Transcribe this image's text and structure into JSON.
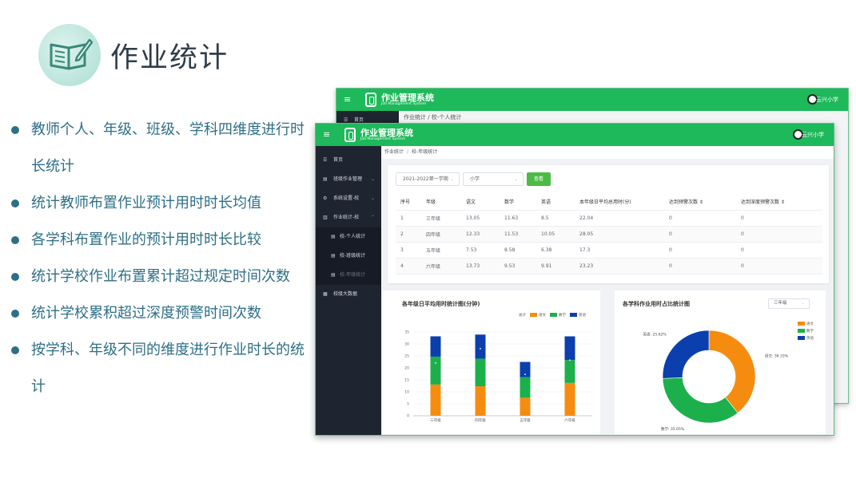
{
  "slide": {
    "title": "作业统计",
    "bullets": [
      "教师个人、年级、班级、学科四维度进行时长统计",
      "统计教师布置作业预计用时时长均值",
      "各学科布置作业的预计用时时长比较",
      "统计学校作业布置累计超过规定时间次数",
      "统计学校累积超过深度预警时间次数",
      "按学科、年级不同的维度进行作业时长的统计"
    ],
    "icon": "book-pen-icon",
    "accent": "#2e6f86"
  },
  "back_window": {
    "nav_first": "首页",
    "crumb": "作业统计 / 校-个人统计"
  },
  "app": {
    "logo_title": "作业管理系统",
    "logo_sub": "Job Management System",
    "user_name": "云兴小学",
    "header_color": "#1db95a",
    "sidebar": [
      {
        "label": "首页",
        "icon": "home-icon"
      },
      {
        "label": "班级作业管理",
        "icon": "doc-icon",
        "arrow": "⌄"
      },
      {
        "label": "系统设置-校",
        "icon": "settings-icon",
        "arrow": "⌄"
      },
      {
        "label": "作业统计-校",
        "icon": "chart-icon",
        "arrow": "⌃"
      },
      {
        "label": "校-个人统计",
        "icon": "doc-icon",
        "sub": true
      },
      {
        "label": "校-班级统计",
        "icon": "doc-icon",
        "sub": true
      },
      {
        "label": "校-年级统计",
        "icon": "doc-icon",
        "sub": true,
        "active": true
      },
      {
        "label": "校级大数据",
        "icon": "grid-icon"
      }
    ],
    "breadcrumb": [
      "作业统计",
      "校-年级统计"
    ],
    "filters": {
      "term": "2021-2022第一学期",
      "level": "小学",
      "query_label": "查看"
    },
    "table": {
      "headers": [
        "序号",
        "年级",
        "语文",
        "数学",
        "英语",
        "本年级日平均总用时(分)",
        "达到预警次数 ⇕",
        "达到深度预警次数 ⇕"
      ],
      "rows": [
        [
          "1",
          "三年级",
          "13.05",
          "11.63",
          "8.5",
          "22.04",
          "0",
          "0"
        ],
        [
          "2",
          "四年级",
          "12.33",
          "11.53",
          "10.05",
          "28.05",
          "0",
          "0"
        ],
        [
          "3",
          "五年级",
          "7.53",
          "8.58",
          "6.38",
          "17.3",
          "0",
          "0"
        ],
        [
          "4",
          "六年级",
          "13.73",
          "9.53",
          "9.91",
          "23.23",
          "0",
          "0"
        ]
      ]
    },
    "bar_card": {
      "title": "各年级日平均用时统计图(分钟)",
      "legend_total": "总计",
      "legend_items": [
        "语文",
        "数学",
        "英语"
      ]
    },
    "pie_card": {
      "title": "各学科作业用时占比统计图",
      "grade_select": "三年级",
      "legend_items": [
        "语文",
        "数学",
        "英语"
      ]
    }
  },
  "colors": {
    "chinese": "#f68c0f",
    "math": "#1bb04b",
    "english": "#0b3fae",
    "total": "#ffffff"
  },
  "chart_data": [
    {
      "type": "bar",
      "title": "各年级日平均用时统计图(分钟)",
      "stacked": true,
      "categories": [
        "三年级",
        "四年级",
        "五年级",
        "六年级"
      ],
      "series": [
        {
          "name": "语文",
          "values": [
            13.05,
            12.33,
            7.53,
            13.73
          ]
        },
        {
          "name": "数学",
          "values": [
            11.63,
            11.53,
            8.58,
            9.53
          ]
        },
        {
          "name": "英语",
          "values": [
            8.5,
            10.05,
            6.38,
            9.91
          ]
        },
        {
          "name": "总计",
          "values": [
            22.04,
            28.05,
            17.3,
            23.23
          ]
        }
      ],
      "yticks": [
        0,
        5,
        10,
        15,
        20,
        25,
        30,
        35
      ],
      "ylim": [
        0,
        35
      ],
      "legend": "top-right"
    },
    {
      "type": "pie",
      "title": "各学科作业用时占比统计图",
      "donut": true,
      "labels": [
        "语文",
        "数学",
        "英语"
      ],
      "values": [
        39.33,
        35.05,
        25.62
      ],
      "slice_labels": [
        "语文: 39.33%",
        "数学: 35.05%",
        "英语: 25.62%"
      ],
      "legend": "right"
    }
  ]
}
